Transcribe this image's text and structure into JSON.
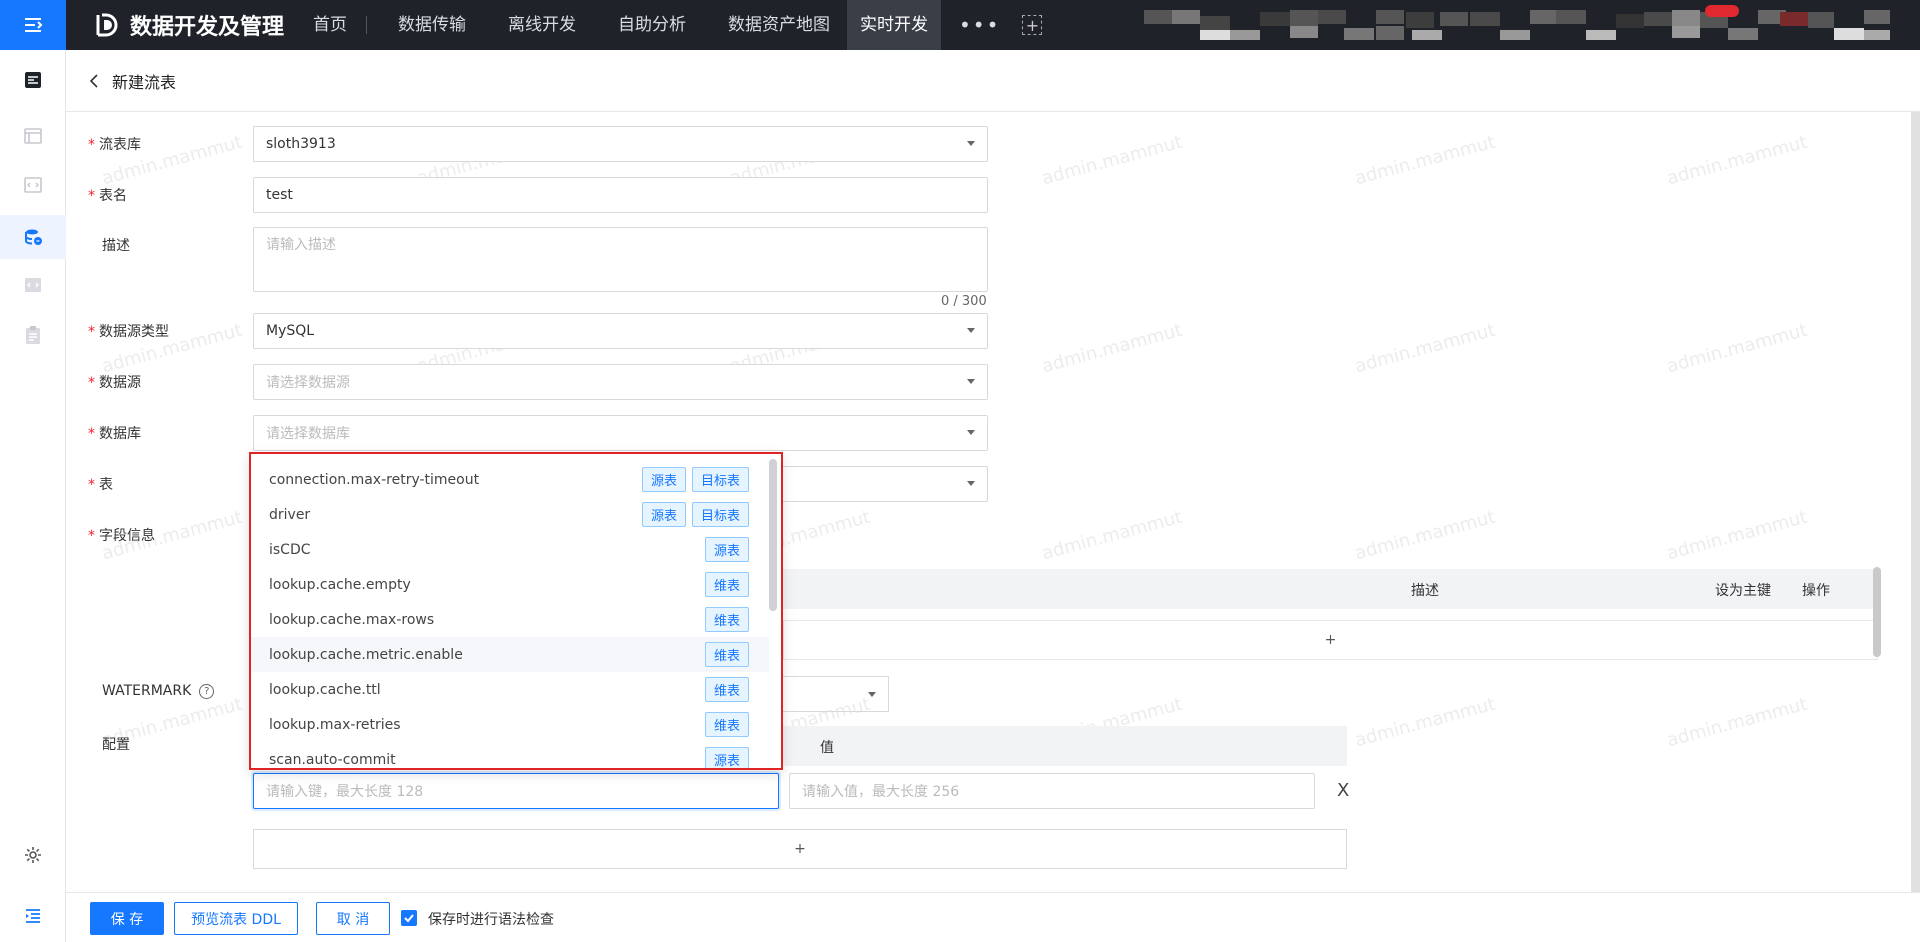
{
  "app": {
    "title": "数据开发及管理"
  },
  "nav": {
    "items": [
      {
        "label": "首页"
      },
      {
        "label": "数据传输"
      },
      {
        "label": "离线开发"
      },
      {
        "label": "自助分析"
      },
      {
        "label": "数据资产地图"
      },
      {
        "label": "实时开发",
        "active": true
      }
    ],
    "more": "•••",
    "add": "+"
  },
  "header": {
    "title": "新建流表"
  },
  "form": {
    "stream_db": {
      "label": "流表库",
      "value": "sloth3913"
    },
    "table_name": {
      "label": "表名",
      "value": "test"
    },
    "description": {
      "label": "描述",
      "placeholder": "请输入描述",
      "counter": "0 / 300"
    },
    "source_type": {
      "label": "数据源类型",
      "value": "MySQL"
    },
    "datasource": {
      "label": "数据源",
      "placeholder": "请选择数据源"
    },
    "database": {
      "label": "数据库",
      "placeholder": "请选择数据库"
    },
    "table": {
      "label": "表"
    },
    "fields": {
      "label": "字段信息"
    },
    "watermark": {
      "label": "WATERMARK",
      "help": "?"
    },
    "config": {
      "label": "配置"
    }
  },
  "field_table": {
    "headers": {
      "desc": "描述",
      "pk": "设为主键",
      "op": "操作"
    },
    "add": "+"
  },
  "config_table": {
    "value_header": "值",
    "key_placeholder": "请输入键，最大长度 128",
    "value_placeholder": "请输入值，最大长度 256",
    "delete": "X",
    "add": "+"
  },
  "dropdown": {
    "items": [
      {
        "key": "connection.max-retry-timeout",
        "tags": [
          "源表",
          "目标表"
        ]
      },
      {
        "key": "driver",
        "tags": [
          "源表",
          "目标表"
        ]
      },
      {
        "key": "isCDC",
        "tags": [
          "源表"
        ]
      },
      {
        "key": "lookup.cache.empty",
        "tags": [
          "维表"
        ]
      },
      {
        "key": "lookup.cache.max-rows",
        "tags": [
          "维表"
        ]
      },
      {
        "key": "lookup.cache.metric.enable",
        "tags": [
          "维表"
        ],
        "highlight": true
      },
      {
        "key": "lookup.cache.ttl",
        "tags": [
          "维表"
        ]
      },
      {
        "key": "lookup.max-retries",
        "tags": [
          "维表"
        ]
      },
      {
        "key": "scan.auto-commit",
        "tags": [
          "源表"
        ]
      }
    ]
  },
  "footer": {
    "save": "保 存",
    "preview": "预览流表 DDL",
    "cancel": "取 消",
    "syntax_check": "保存时进行语法检查"
  },
  "watermark_text": "admin.mammut",
  "colors": {
    "primary": "#1677ff",
    "topbar": "#1f2329",
    "required": "#f5222d",
    "highlight_border": "#e02424"
  }
}
